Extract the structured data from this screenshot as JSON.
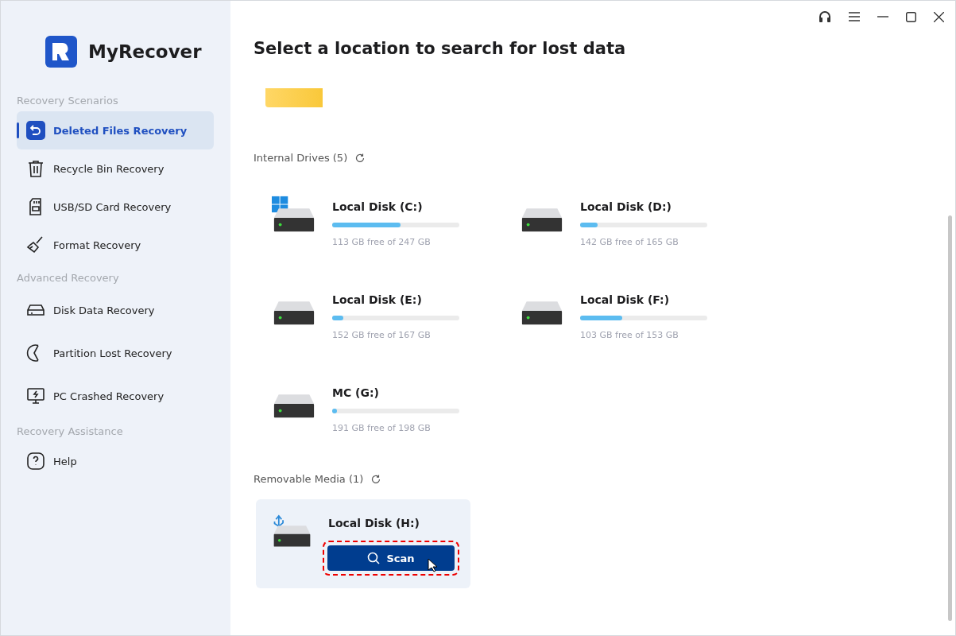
{
  "app": {
    "name": "MyRecover"
  },
  "sidebar": {
    "groups": [
      {
        "heading": "Recovery Scenarios",
        "items": [
          {
            "label": "Deleted Files Recovery",
            "kind": "restore",
            "selected": true
          },
          {
            "label": "Recycle Bin Recovery",
            "kind": "trash",
            "selected": false
          },
          {
            "label": "USB/SD Card Recovery",
            "kind": "sdcard",
            "selected": false
          },
          {
            "label": "Format Recovery",
            "kind": "broom",
            "selected": false
          }
        ]
      },
      {
        "heading": "Advanced Recovery",
        "items": [
          {
            "label": "Disk Data Recovery",
            "kind": "disk",
            "selected": false
          },
          {
            "label": "Partition Lost Recovery",
            "kind": "partition",
            "selected": false
          },
          {
            "label": "PC Crashed Recovery",
            "kind": "monitor",
            "selected": false
          }
        ]
      },
      {
        "heading": "Recovery Assistance",
        "items": [
          {
            "label": "Help",
            "kind": "help",
            "selected": false
          }
        ]
      }
    ]
  },
  "title": "Select a location to search for lost data",
  "sections": [
    {
      "heading": "Internal Drives (5)",
      "drives": [
        {
          "name": "Local Disk (C:)",
          "system": true,
          "level": 0.54,
          "reading": "113 GB free of 247 GB"
        },
        {
          "name": "Local Disk (D:)",
          "system": false,
          "level": 0.14,
          "reading": "142 GB free of 165 GB"
        },
        {
          "name": "Local Disk (E:)",
          "system": false,
          "level": 0.09,
          "reading": "152 GB free of 167 GB"
        },
        {
          "name": "Local Disk (F:)",
          "system": false,
          "level": 0.33,
          "reading": "103 GB free of 153 GB"
        },
        {
          "name": "MC (G:)",
          "system": false,
          "level": 0.035,
          "reading": "191 GB free of 198 GB"
        }
      ]
    },
    {
      "heading": "Removable Media (1)",
      "drives": [
        {
          "name": "Local Disk (H:)",
          "usb": true,
          "hovered": true,
          "button": "Scan",
          "highlighted": true
        }
      ]
    }
  ]
}
